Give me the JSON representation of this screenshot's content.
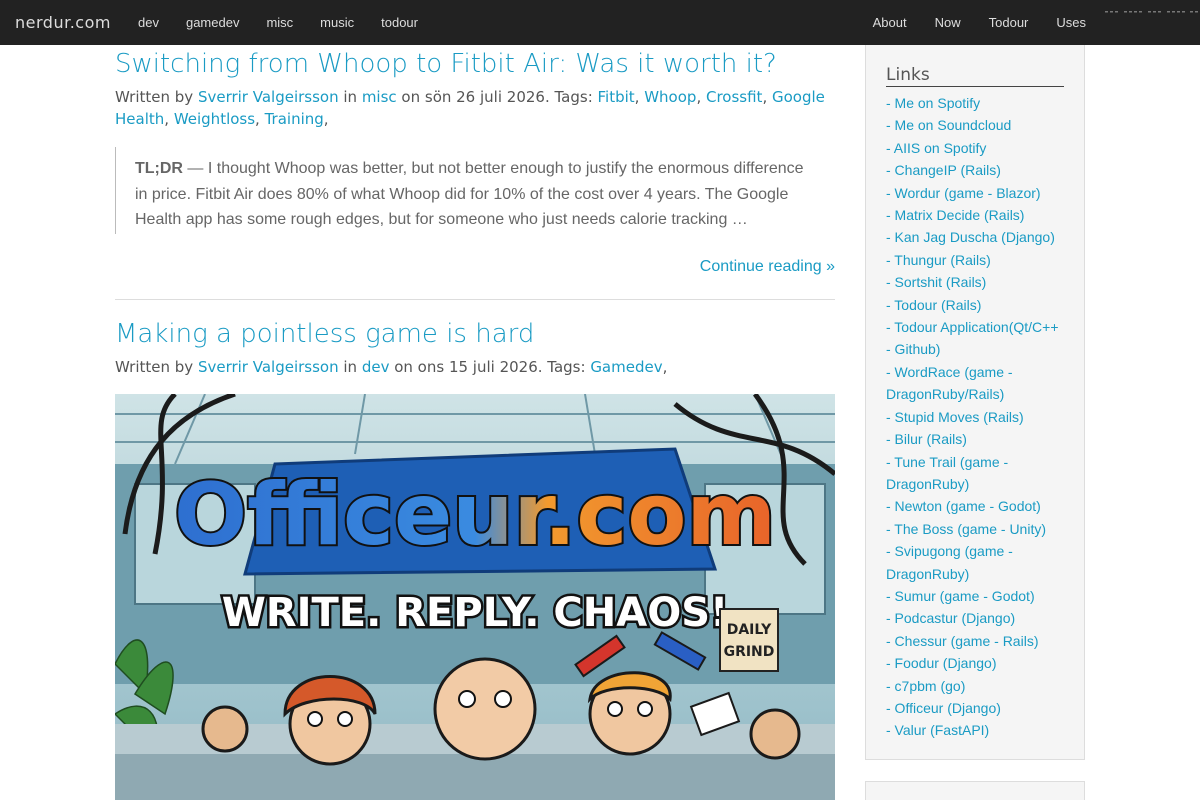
{
  "navbar": {
    "brand": "nerdur.com",
    "left_links": [
      "dev",
      "gamedev",
      "misc",
      "music",
      "todour"
    ],
    "right_links": [
      "About",
      "Now",
      "Todour",
      "Uses"
    ]
  },
  "posts": [
    {
      "title": "Switching from Whoop to Fitbit Air: Was it worth it?",
      "meta_written_by": "Written by ",
      "author": "Sverrir Valgeirsson",
      "meta_in": " in ",
      "category": "misc",
      "meta_date": " on sön 26 juli 2026. Tags: ",
      "tags": [
        "Fitbit",
        "Whoop",
        "Crossfit",
        "Google Health",
        "Weightloss",
        "Training"
      ],
      "excerpt_lead": "TL;DR",
      "excerpt_text": " — I thought Whoop was better, but not better enough to justify the enormous difference in price. Fitbit Air does 80% of what Whoop did for 10% of the cost over 4 years. The Google Health app has some rough edges, but for someone who just needs calorie tracking …",
      "continue_label": "Continue reading »"
    },
    {
      "title": "Making a pointless game is hard",
      "meta_written_by": "Written by ",
      "author": "Sverrir Valgeirsson",
      "meta_in": " in ",
      "category": "dev",
      "meta_date": " on ons 15 juli 2026. Tags: ",
      "tags": [
        "Gamedev"
      ],
      "image": {
        "headline": "Officeur.com",
        "tagline": "WRITE. REPLY. CHAOS!",
        "sign_line1": "DAILY",
        "sign_line2": "GRIND"
      }
    }
  ],
  "sidebar": {
    "heading": "Links",
    "links": [
      "- Me on Spotify",
      "- Me on Soundcloud",
      "- AIIS on Spotify",
      "- ChangeIP (Rails)",
      "- Wordur (game - Blazor)",
      "- Matrix Decide (Rails)",
      "- Kan Jag Duscha (Django)",
      "- Thungur (Rails)",
      "- Sortshit (Rails)",
      "- Todour (Rails)",
      "- Todour Application(Qt/C++",
      "- Github)",
      "- WordRace (game - DragonRuby/Rails)",
      "- Stupid Moves (Rails)",
      "- Bilur (Rails)",
      "- Tune Trail (game - DragonRuby)",
      "- Newton (game - Godot)",
      "- The Boss (game - Unity)",
      "- Svipugong (game - DragonRuby)",
      "- Sumur (game - Godot)",
      "- Podcastur (Django)",
      "- Chessur (game - Rails)",
      "- Foodur (Django)",
      "- c7pbm (go)",
      "- Officeur (Django)",
      "- Valur (FastAPI)"
    ]
  },
  "colors": {
    "link": "#1a9bc4",
    "navbar_bg": "#222222",
    "navbar_text": "#dddddd",
    "sidebar_bg": "#f5f5f5"
  }
}
